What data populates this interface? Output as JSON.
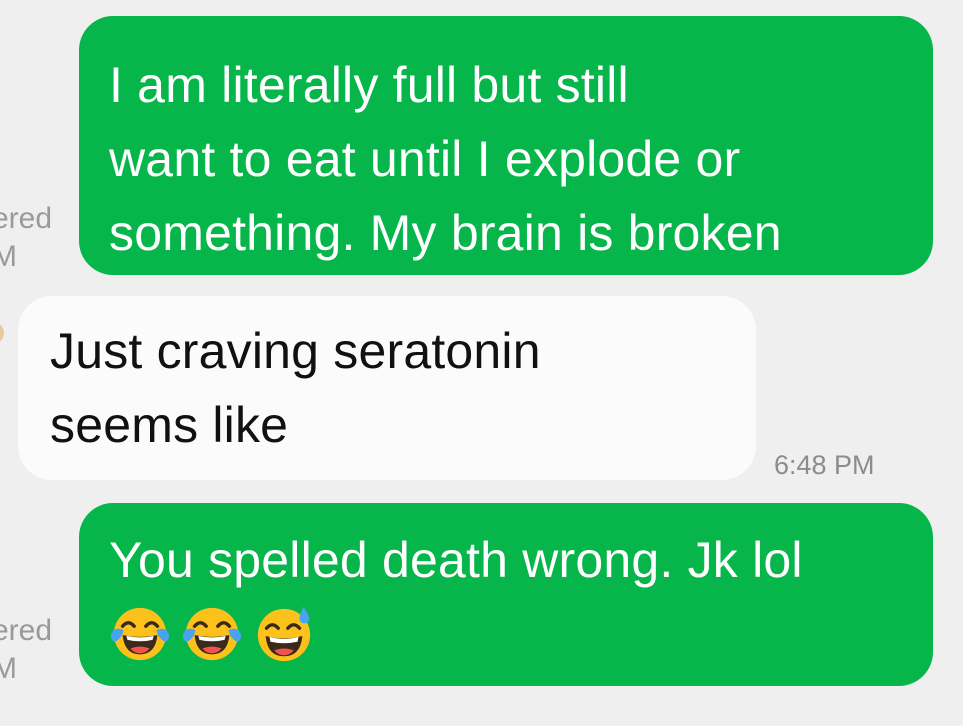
{
  "messages": [
    {
      "direction": "sent",
      "lines": [
        "I am literally full but still",
        "want to eat until I explode or",
        "something. My brain is broken"
      ],
      "status": {
        "line1": "ered",
        "line2": "M"
      }
    },
    {
      "direction": "received",
      "lines": [
        "Just craving seratonin",
        "seems like"
      ],
      "time": "6:48 PM"
    },
    {
      "direction": "sent",
      "lines": [
        "You spelled death wrong. Jk lol"
      ],
      "emojis": [
        "face-with-tears-of-joy",
        "face-with-tears-of-joy",
        "grinning-face-with-sweat"
      ],
      "status": {
        "line1": "ered",
        "line2": "M"
      }
    }
  ],
  "colors": {
    "background": "#efefef",
    "sent_bubble": "#06b64a",
    "received_bubble": "#fbfbfb",
    "meta_text": "#8c8c8c"
  }
}
